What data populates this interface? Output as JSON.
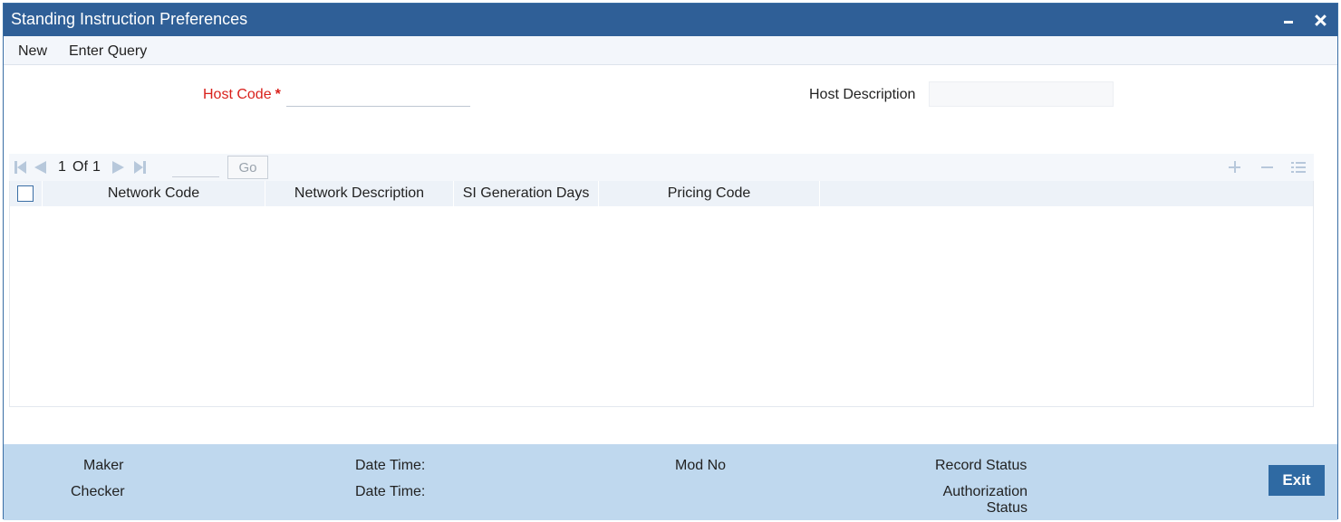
{
  "window": {
    "title": "Standing Instruction Preferences",
    "minimize_icon": "minimize-icon",
    "close_icon": "close-icon"
  },
  "menu": {
    "new_label": "New",
    "enter_query_label": "Enter Query"
  },
  "form": {
    "host_code_label": "Host Code",
    "host_code_required": "*",
    "host_code_value": "",
    "host_description_label": "Host Description",
    "host_description_value": ""
  },
  "pagination": {
    "current": "1",
    "of_label": "Of",
    "total": "1",
    "go_label": "Go",
    "page_input_value": ""
  },
  "grid": {
    "columns": [
      "Network Code",
      "Network Description",
      "SI Generation Days",
      "Pricing Code"
    ],
    "rows": []
  },
  "footer": {
    "maker_label": "Maker",
    "checker_label": "Checker",
    "date_time_label_1": "Date Time:",
    "date_time_label_2": "Date Time:",
    "mod_no_label": "Mod No",
    "record_status_label": "Record Status",
    "authorization_status_label_line1": "Authorization",
    "authorization_status_label_line2": "Status",
    "exit_label": "Exit"
  },
  "colors": {
    "titlebar": "#2f5f97",
    "footer": "#bfd8ee",
    "required_label": "#d9211c",
    "exit_button": "#2f6aa3"
  }
}
